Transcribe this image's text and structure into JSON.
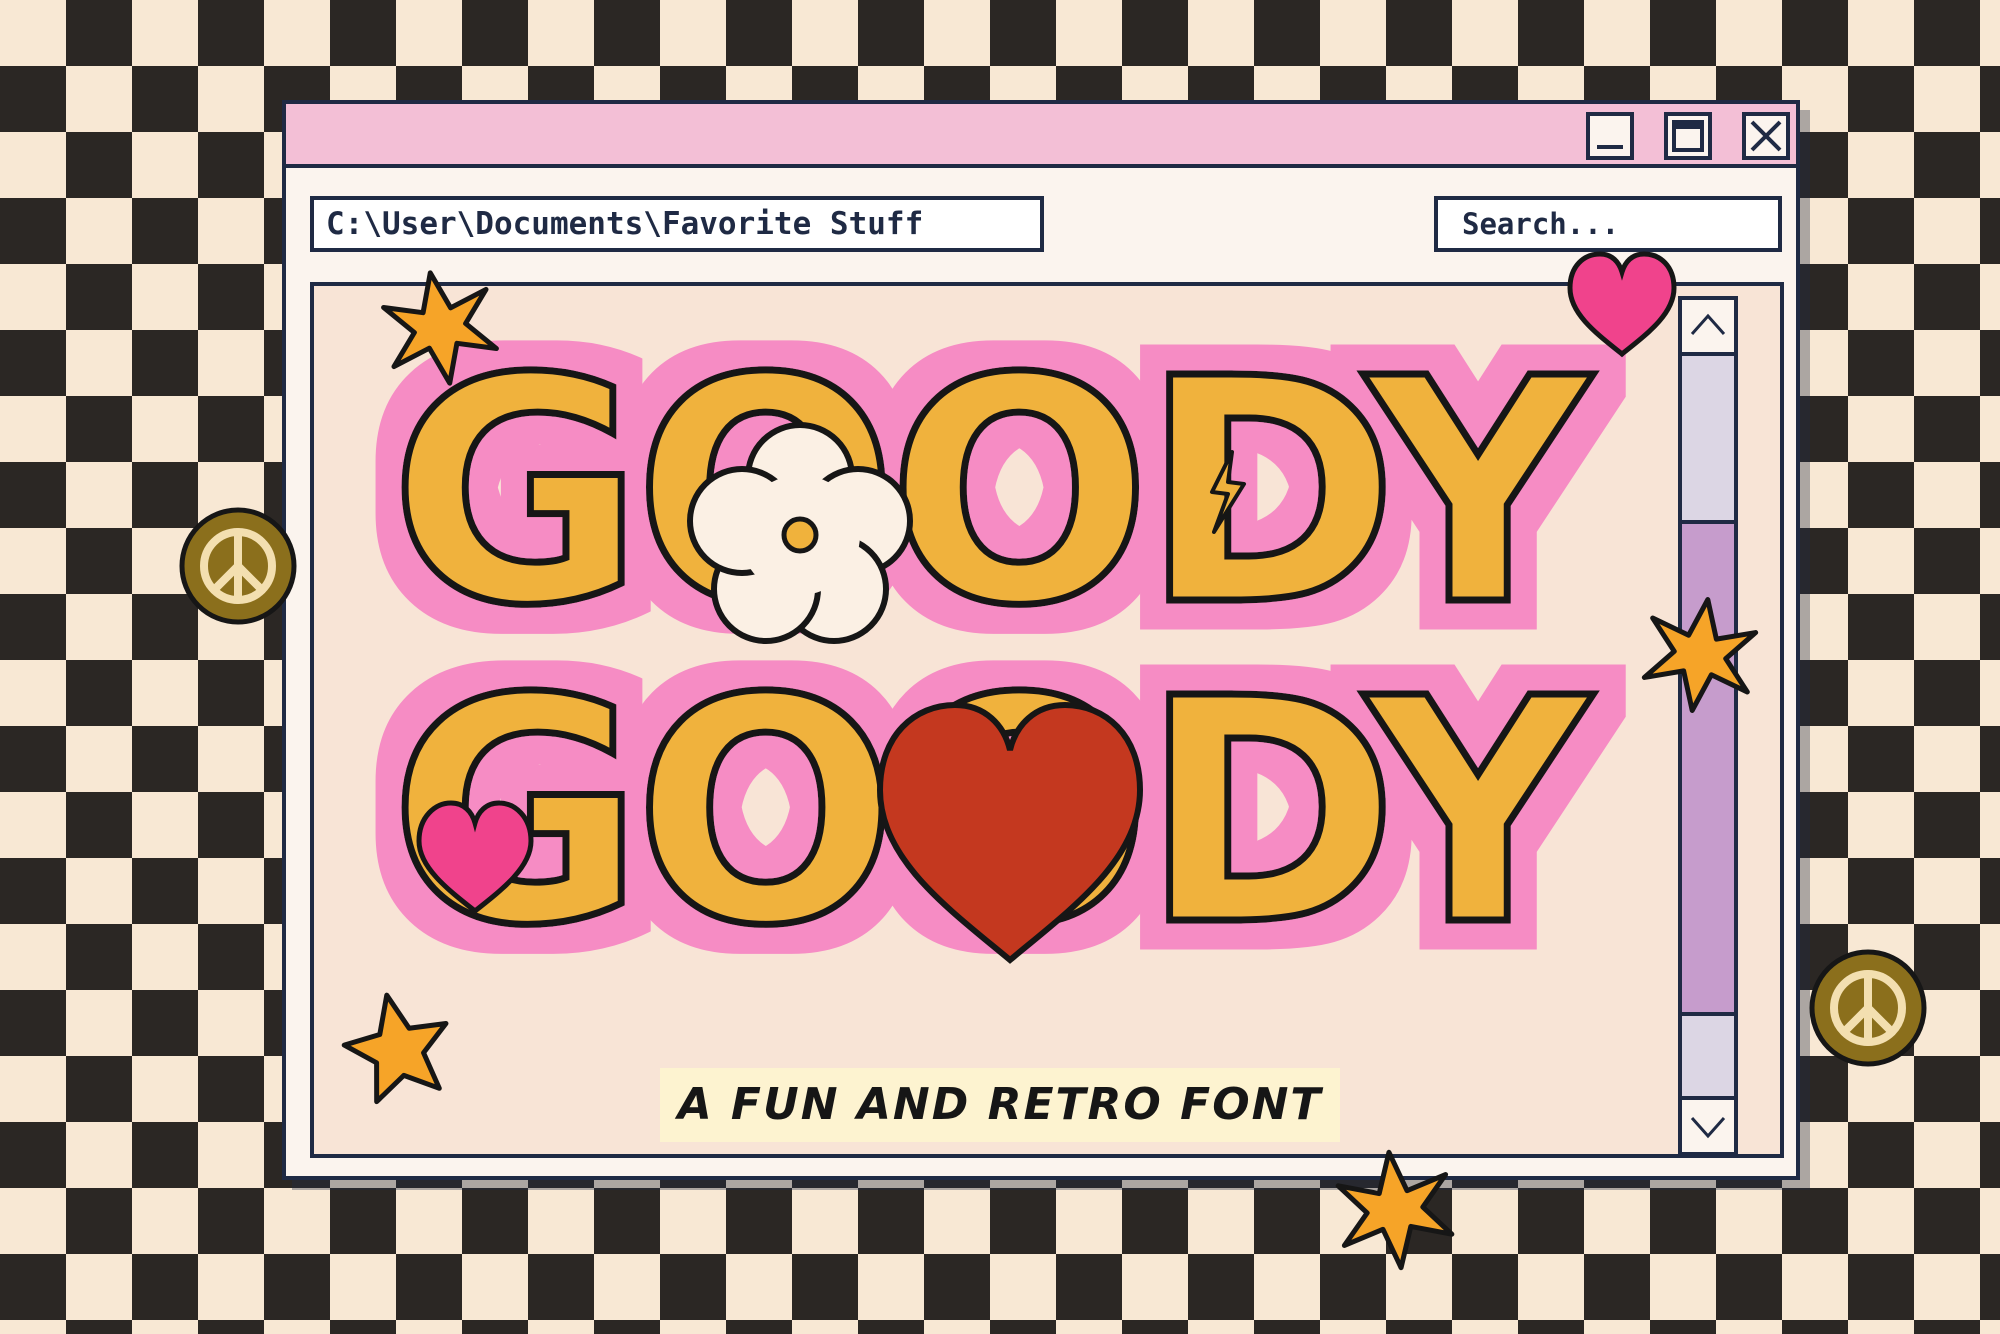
{
  "window": {
    "address_path": "C:\\User\\Documents\\Favorite Stuff",
    "search_placeholder": "Search...",
    "buttons": [
      "minimize",
      "maximize",
      "close"
    ]
  },
  "content": {
    "headline_line1": "GOODY",
    "headline_line2": "GOODY",
    "tagline": "A FUN AND RETRO FONT"
  },
  "colors": {
    "window_titlebar": "#f3bfd6",
    "window_border": "#1f2a44",
    "content_background": "#f8e4d6",
    "scrollbar_thumb": "#c69ccc",
    "headline_letters": "#f0b23c",
    "headline_outline_glow": "#f68cc4",
    "heart_red": "#c4381f",
    "heart_pink": "#f0438c",
    "star_orange": "#f6a428",
    "peace_sign": "#8b6f1c",
    "checker_dark": "#2b2724",
    "checker_light": "#f8e8d4"
  },
  "decorations": [
    "star-icon",
    "heart-icon",
    "peace-sign-icon",
    "flower-icon",
    "lightning-bolt-icon"
  ]
}
